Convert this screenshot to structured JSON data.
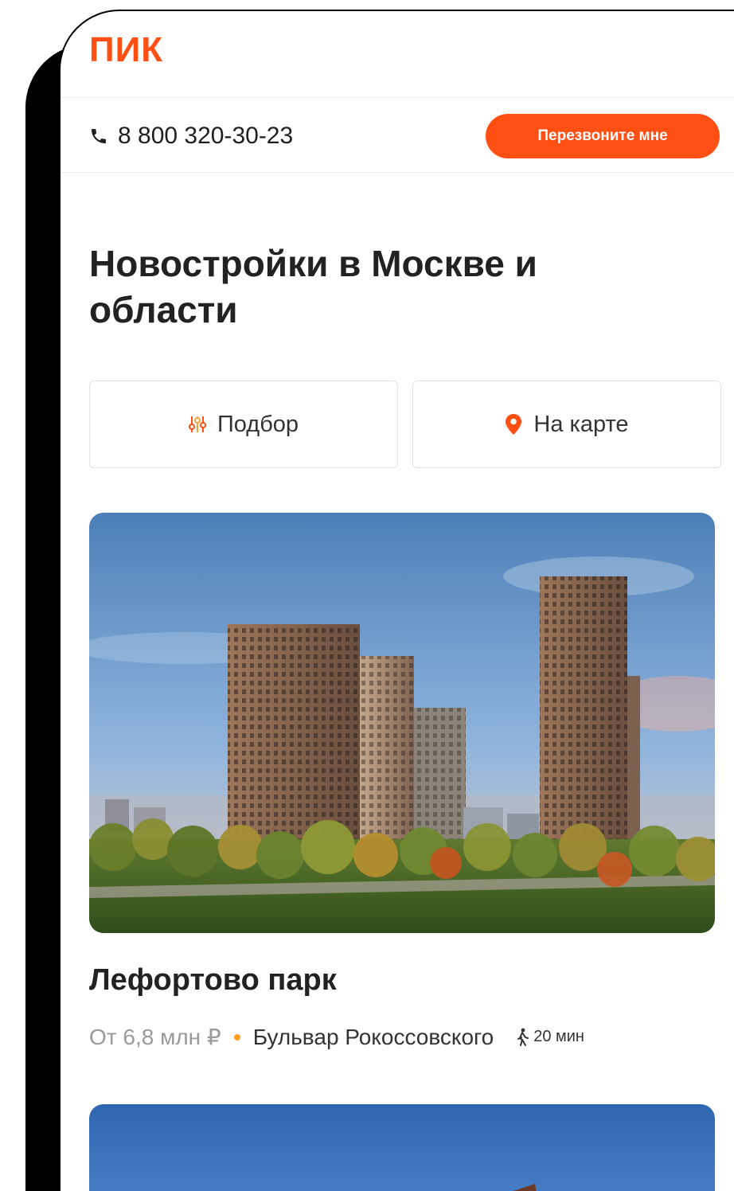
{
  "brand": {
    "logo_text": "ПИК",
    "accent_color": "#ff4f12"
  },
  "contact": {
    "phone_number": "8 800 320-30-23",
    "phone_icon": "phone-icon",
    "callback_label": "Перезвоните мне"
  },
  "page": {
    "title": "Новостройки в Москве и области"
  },
  "filters": {
    "selection_label": "Подбор",
    "selection_icon": "sliders-icon",
    "map_label": "На карте",
    "map_icon": "map-pin-icon"
  },
  "listings": [
    {
      "title": "Лефортово парк",
      "price": "От 6,8 млн ₽",
      "metro": "Бульвар Рокоссовского",
      "walk_time": "20 мин",
      "metro_dot_color": "#ff9f1c"
    }
  ]
}
